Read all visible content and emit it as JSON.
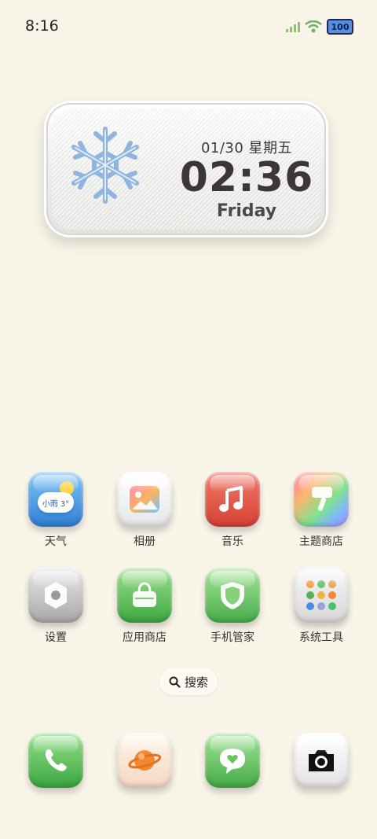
{
  "status_bar": {
    "time": "8:16",
    "battery": "100"
  },
  "widget": {
    "date": "01/30 星期五",
    "time": "02:36",
    "day": "Friday"
  },
  "weather_badge": {
    "text": "小雨 3°"
  },
  "apps_row1": [
    {
      "label": "天气",
      "icon": "weather-icon"
    },
    {
      "label": "相册",
      "icon": "gallery-icon"
    },
    {
      "label": "音乐",
      "icon": "music-icon"
    },
    {
      "label": "主题商店",
      "icon": "theme-store-icon"
    }
  ],
  "apps_row2": [
    {
      "label": "设置",
      "icon": "settings-icon"
    },
    {
      "label": "应用商店",
      "icon": "app-store-icon"
    },
    {
      "label": "手机管家",
      "icon": "security-icon"
    },
    {
      "label": "系统工具",
      "icon": "tools-folder-icon"
    }
  ],
  "search": {
    "label": "搜索"
  },
  "dock": [
    {
      "icon": "phone-icon"
    },
    {
      "icon": "browser-icon"
    },
    {
      "icon": "messages-icon"
    },
    {
      "icon": "camera-icon"
    }
  ]
}
